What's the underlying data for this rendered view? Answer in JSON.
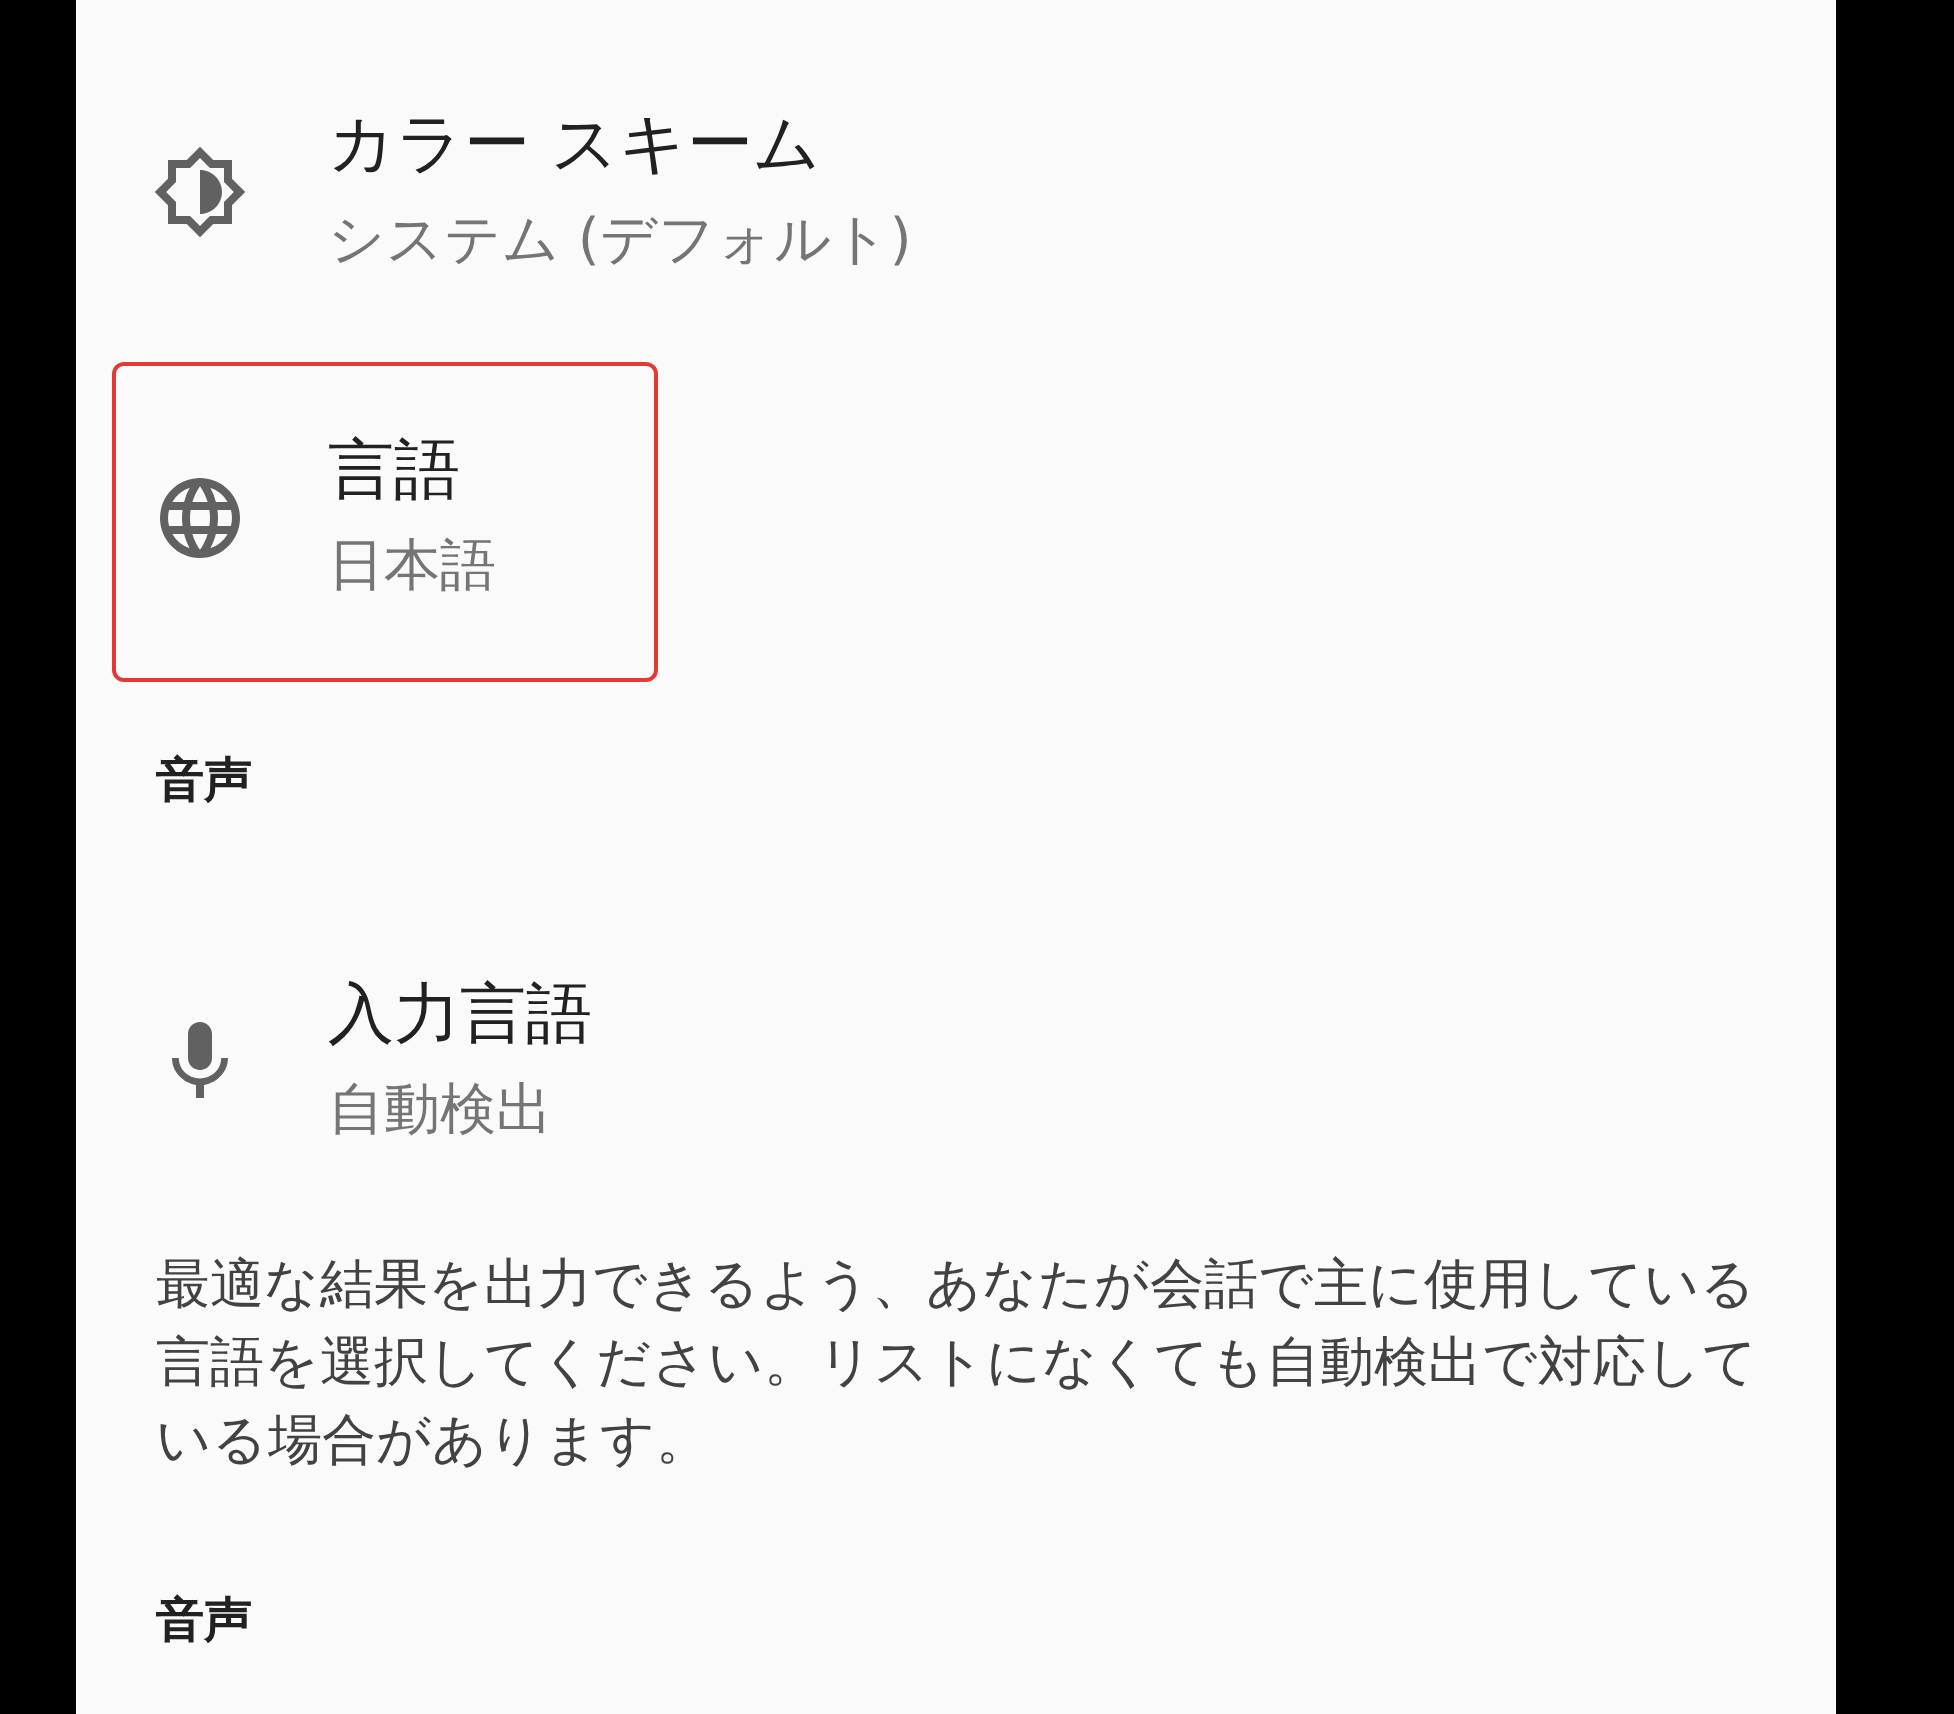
{
  "items": [
    {
      "kind": "setting",
      "title": "カラー スキーム",
      "subtitle": "システム (デフォルト)",
      "highlighted": false
    },
    {
      "kind": "setting",
      "title": "言語",
      "subtitle": "日本語",
      "highlighted": true
    },
    {
      "kind": "header",
      "title": "音声"
    },
    {
      "kind": "setting",
      "title": "入力言語",
      "subtitle": "自動検出",
      "highlighted": false
    },
    {
      "kind": "note",
      "text": "最適な結果を出力できるよう、あなたが会話で主に使用している言語を選択してください。リストになくても自動検出で対応している場合があります。"
    },
    {
      "kind": "header",
      "title": "音声"
    }
  ]
}
